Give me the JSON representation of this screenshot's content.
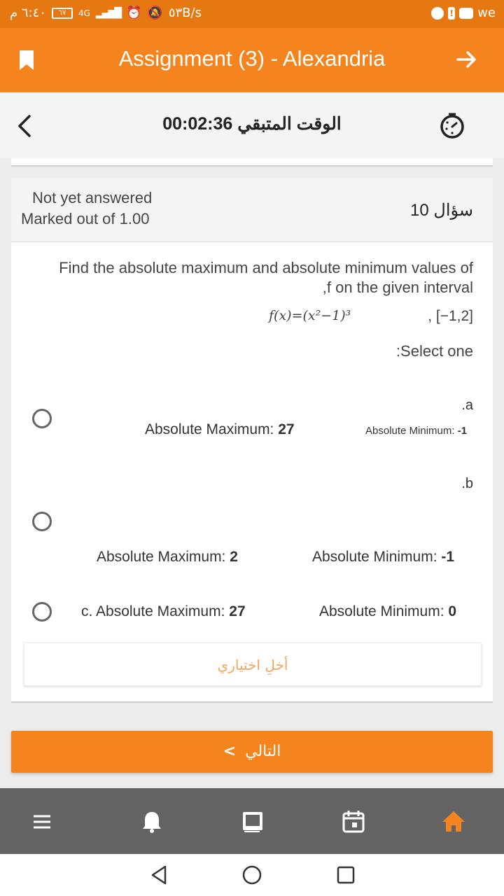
{
  "status_bar": {
    "time": "٦:٤٠ م",
    "battery": "٦٧",
    "network": "4G",
    "speed": "٥٣B/s",
    "carrier": "we"
  },
  "app_bar": {
    "title": "Assignment (3) - Alexandria"
  },
  "timer": {
    "label": "الوقت المتبقي 00:02:36"
  },
  "question": {
    "status": "Not yet answered",
    "marks": "Marked out of 1.00",
    "number": "سؤال 10",
    "text_line1": "Find the absolute maximum and absolute minimum values of",
    "text_line2": ",f on the given interval",
    "formula": "f(x)=(x²−1)³",
    "interval": ", [−1,2]",
    "select_prompt": ":Select one"
  },
  "options": [
    {
      "letter": ".a",
      "max_label": "Absolute Maximum:",
      "max_value": "27",
      "min_label": "Absolute Minimum:",
      "min_value": "-1"
    },
    {
      "letter": ".b",
      "max_label": "Absolute Maximum:",
      "max_value": "2",
      "min_label": "Absolute Minimum:",
      "min_value": "-1"
    },
    {
      "letter": "c.",
      "max_label": "Absolute Maximum:",
      "max_value": "27",
      "min_label": "Absolute Minimum:",
      "min_value": "0"
    }
  ],
  "clear_choice": "أخلِ اختياري",
  "next_button": "التالي",
  "tabs": [
    "menu-icon",
    "bell-icon",
    "assignment-icon",
    "calendar-icon",
    "home-icon"
  ],
  "colors": {
    "primary": "#f5841f",
    "statusbar": "#e57810",
    "tabbar": "#636363"
  }
}
